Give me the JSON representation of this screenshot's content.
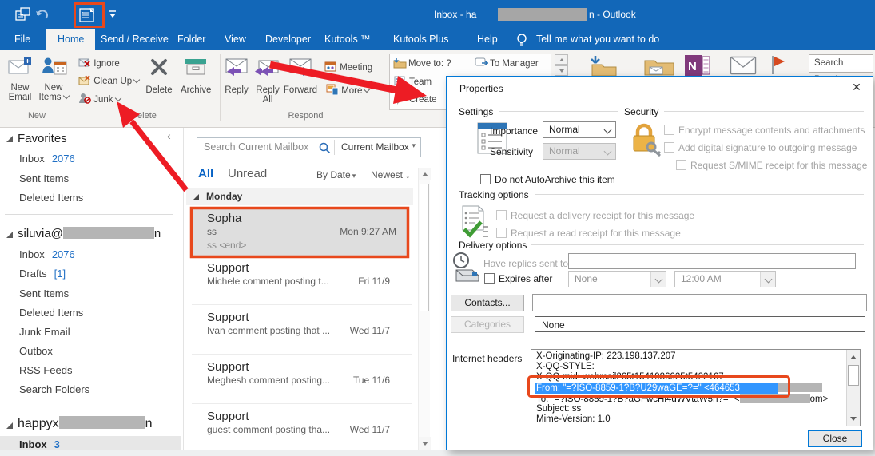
{
  "window": {
    "title_prefix": "Inbox - ha",
    "title_suffix": "n  -  Outlook"
  },
  "icons": {
    "dropdown": "▾",
    "sort_down": "↓",
    "close": "✕",
    "collapse": "‹"
  },
  "colors": {
    "titlebar_blue": "#1267b8",
    "annotation_red": "#ed1c24",
    "annotation_orange": "#e8481c",
    "selection_blue": "#3296ff",
    "dialog_border": "#0078d7",
    "unread_count_blue": "#1f6fc5"
  },
  "tabs": {
    "items": [
      "File",
      "Home",
      "Send / Receive",
      "Folder",
      "View",
      "Developer",
      "Kutools ™",
      "Kutools Plus",
      "Help"
    ],
    "selected": "Home",
    "tell_me": "Tell me what you want to do"
  },
  "ribbon": {
    "new_group": {
      "label": "New",
      "new_email": "New Email",
      "new_items": "New Items"
    },
    "delete_group": {
      "label": "Delete",
      "ignore": "Ignore",
      "clean_up": "Clean Up",
      "junk": "Junk",
      "delete": "Delete",
      "archive": "Archive"
    },
    "respond_group": {
      "label": "Respond",
      "reply": "Reply",
      "reply_all_1": "Reply",
      "reply_all_2": "All",
      "forward": "Forward",
      "meeting": "Meeting",
      "more": "More"
    },
    "quick_steps": {
      "move_to": "Move to: ?",
      "to_manager": "To Manager",
      "team": "Team",
      "create": "Create"
    },
    "search_people": "Search People"
  },
  "sidebar": {
    "sections": [
      {
        "name": "Favorites",
        "items": [
          {
            "label": "Inbox",
            "count": "2076"
          },
          {
            "label": "Sent Items"
          },
          {
            "label": "Deleted Items"
          }
        ]
      },
      {
        "name": "siluvia@",
        "name_suffix": "n",
        "items": [
          {
            "label": "Inbox",
            "count": "2076"
          },
          {
            "label": "Drafts",
            "count": "[1]"
          },
          {
            "label": "Sent Items"
          },
          {
            "label": "Deleted Items"
          },
          {
            "label": "Junk Email"
          },
          {
            "label": "Outbox"
          },
          {
            "label": "RSS Feeds"
          },
          {
            "label": "Search Folders"
          }
        ]
      },
      {
        "name": "happyx",
        "name_suffix": "n",
        "items": [
          {
            "label": "Inbox",
            "count": "3"
          }
        ]
      }
    ]
  },
  "list": {
    "search_placeholder": "Search Current Mailbox",
    "mailbox_filter": "Current Mailbox",
    "tab_all": "All",
    "tab_unread": "Unread",
    "sort_label": "By Date",
    "sort_order": "Newest",
    "group": "Monday",
    "messages": [
      {
        "sender": "Sopha",
        "line2": "ss",
        "date": "Mon 9:27 AM",
        "preview": "ss <end>"
      },
      {
        "sender": "Support",
        "line2": "Michele comment posting t...",
        "date": "Fri 11/9"
      },
      {
        "sender": "Support",
        "line2": "Ivan comment posting that ...",
        "date": "Wed 11/7"
      },
      {
        "sender": "Support",
        "line2": "Meghesh comment posting...",
        "date": "Tue 11/6"
      },
      {
        "sender": "Support",
        "line2": "guest comment posting tha...",
        "date": "Wed 11/7"
      }
    ]
  },
  "dialog": {
    "title": "Properties",
    "settings": {
      "label": "Settings",
      "importance_label": "Importance",
      "importance_value": "Normal",
      "sensitivity_label": "Sensitivity",
      "sensitivity_value": "Normal",
      "autoarchive": "Do not AutoArchive this item"
    },
    "security": {
      "label": "Security",
      "encrypt": "Encrypt message contents and attachments",
      "sign": "Add digital signature to outgoing message",
      "smime": "Request S/MIME receipt for this message"
    },
    "tracking": {
      "label": "Tracking options",
      "delivery_receipt": "Request a delivery receipt for this message",
      "read_receipt": "Request a read receipt for this message"
    },
    "delivery": {
      "label": "Delivery options",
      "have_replies": "Have replies sent to",
      "expires": "Expires after",
      "expires_value": "None",
      "expires_time": "12:00 AM"
    },
    "contacts_button": "Contacts...",
    "categories_button": "Categories",
    "categories_value": "None",
    "internet_headers_label": "Internet headers",
    "headers": {
      "line1": "X-Originating-IP: 223.198.137.207",
      "line2": "X-QQ-STYLE:",
      "line3": "X-QQ-mid: webmail265t1541986025t5422167",
      "from_prefix": "From: \"=?ISO-8859-1?B?U29waGE=?=\" <464653",
      "to_prefix": "To: \"=?ISO-8859-1?B?aGFwcHl4dWVtaW5n?=\" <",
      "to_suffix": "om>",
      "line6": "Subject: ss",
      "line7": "Mime-Version: 1.0"
    },
    "close_button": "Close"
  }
}
